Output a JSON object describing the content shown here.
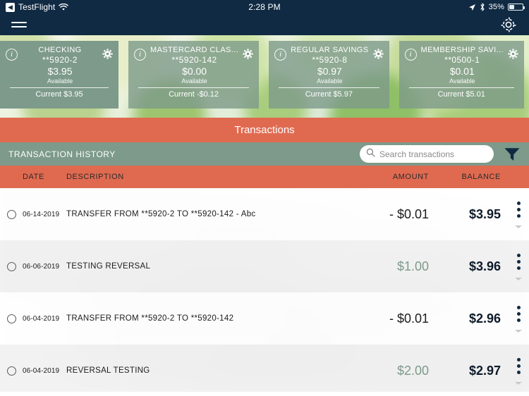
{
  "status_bar": {
    "back_app": "TestFlight",
    "back_icon": "chevron-left-icon",
    "wifi_icon": "wifi-icon",
    "time": "2:28 PM",
    "location_icon": "location-arrow-icon",
    "bluetooth_icon": "bluetooth-icon",
    "battery_percent": "35%",
    "battery_level": 35
  },
  "nav_bar": {
    "menu_icon": "hamburger-menu-icon",
    "settings_icon": "gear-icon"
  },
  "accounts": [
    {
      "name": "CHECKING",
      "number": "**5920-2",
      "amount": "$3.95",
      "available_label": "Available",
      "current": "Current $3.95",
      "info_icon": "info-icon",
      "gear_icon": "gear-icon",
      "style": "solid"
    },
    {
      "name": "MASTERCARD CLAS...",
      "number": "**5920-142",
      "amount": "$0.00",
      "available_label": "Available",
      "current": "Current -$0.12",
      "info_icon": "info-icon",
      "gear_icon": "gear-icon",
      "style": "glassy"
    },
    {
      "name": "REGULAR SAVINGS",
      "number": "**5920-8",
      "amount": "$0.97",
      "available_label": "Available",
      "current": "Current $5.97",
      "info_icon": "info-icon",
      "gear_icon": "gear-icon",
      "style": "glassy"
    },
    {
      "name": "MEMBERSHIP SAVI...",
      "number": "**0500-1",
      "amount": "$0.01",
      "available_label": "Available",
      "current": "Current $5.01",
      "info_icon": "info-icon",
      "gear_icon": "gear-icon",
      "style": "glassy"
    }
  ],
  "transactions_panel": {
    "title": "Transactions",
    "history_label": "TRANSACTION HISTORY",
    "search": {
      "placeholder": "Search transactions",
      "value": "",
      "icon": "search-icon"
    },
    "filter_icon": "filter-funnel-icon",
    "columns": {
      "date": "DATE",
      "description": "DESCRIPTION",
      "amount": "AMOUNT",
      "balance": "BALANCE"
    },
    "rows": [
      {
        "date": "06-14-2019",
        "description": "TRANSFER FROM **5920-2 TO **5920-142 - Abc",
        "amount": "- $0.01",
        "amount_type": "debit",
        "balance": "$3.95",
        "checkbox_icon": "circle-checkbox-icon",
        "menu_icon": "more-vertical-icon",
        "expand_icon": "chevron-down-icon"
      },
      {
        "date": "06-06-2019",
        "description": "TESTING REVERSAL",
        "amount": "$1.00",
        "amount_type": "credit",
        "balance": "$3.96",
        "checkbox_icon": "circle-checkbox-icon",
        "menu_icon": "more-vertical-icon",
        "expand_icon": "chevron-down-icon"
      },
      {
        "date": "06-04-2019",
        "description": "TRANSFER FROM **5920-2 TO **5920-142",
        "amount": "- $0.01",
        "amount_type": "debit",
        "balance": "$2.96",
        "checkbox_icon": "circle-checkbox-icon",
        "menu_icon": "more-vertical-icon",
        "expand_icon": "chevron-down-icon"
      },
      {
        "date": "06-04-2019",
        "description": "REVERSAL TESTING",
        "amount": "$2.00",
        "amount_type": "credit",
        "balance": "$2.97",
        "checkbox_icon": "circle-checkbox-icon",
        "menu_icon": "more-vertical-icon",
        "expand_icon": "chevron-down-icon"
      }
    ]
  },
  "colors": {
    "navy": "#102a43",
    "coral": "#e06a50",
    "sage": "#7d9a8a",
    "credit_green": "#7d9a8a",
    "white": "#ffffff"
  }
}
